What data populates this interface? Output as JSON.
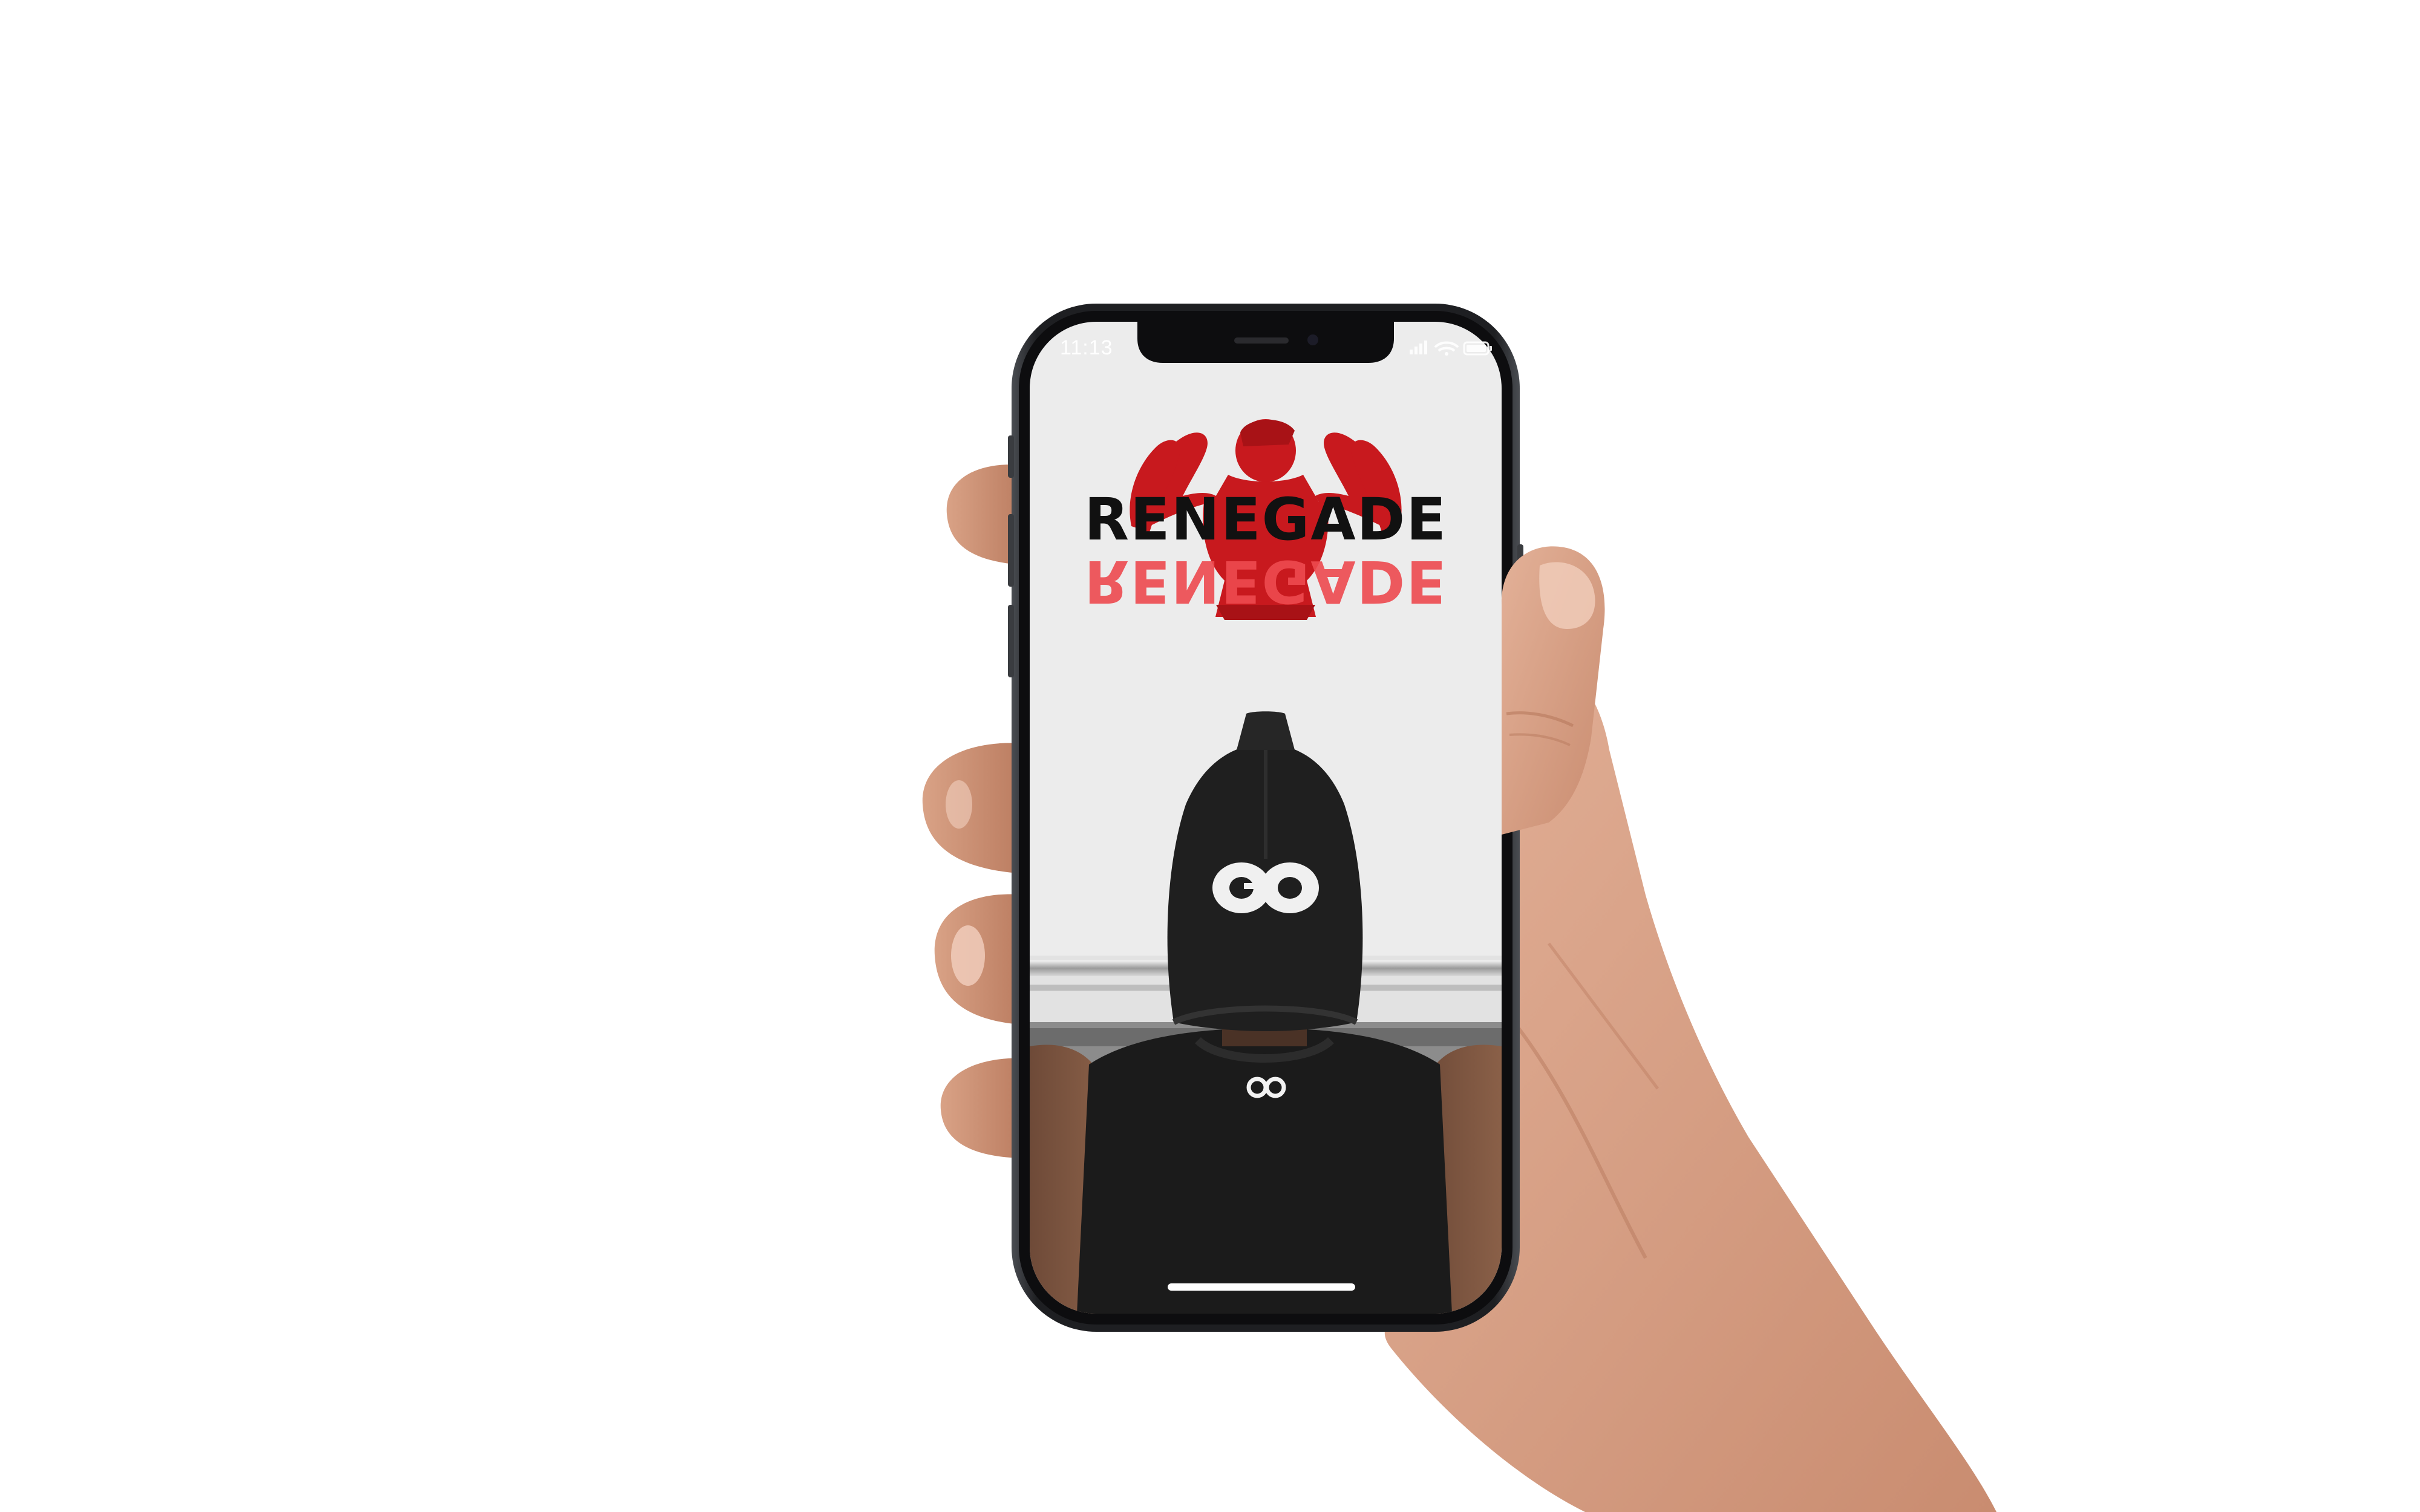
{
  "status_bar": {
    "time": "11:13",
    "icons": [
      "signal-icon",
      "wifi-icon",
      "battery-icon"
    ]
  },
  "logo": {
    "wordmark": "RENEGADE",
    "symbol": "flexing-bodybuilder-silhouette",
    "primary_color": "#c8191e",
    "reflection_color": "#ee4a4f",
    "text_color": "#111111"
  },
  "hero": {
    "subject": "person-in-black-cap-at-barbell",
    "cap_emblem": "GO",
    "shirt_emblem": "GO"
  },
  "device": {
    "frame_color": "#2a2c30",
    "screen_background": "#ececec"
  }
}
